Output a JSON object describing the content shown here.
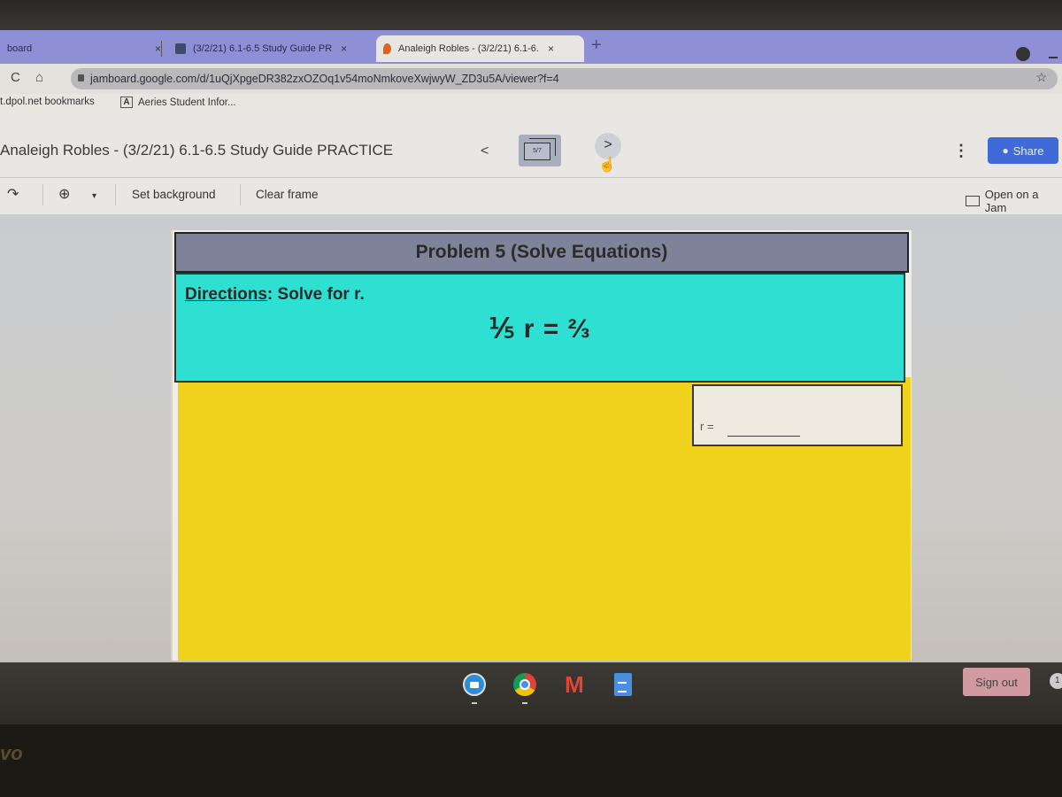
{
  "browser": {
    "tabs": [
      {
        "label": "board",
        "active": false
      },
      {
        "label": "(3/2/21) 6.1-6.5 Study Guide PR",
        "active": false,
        "icon": "classroom-icon"
      },
      {
        "label": "Analeigh Robles - (3/2/21) 6.1-6.",
        "active": true,
        "icon": "jamboard-icon"
      }
    ],
    "close_glyph": "×",
    "new_tab": "+",
    "url": "jamboard.google.com/d/1uQjXpgeDR382zxOZOq1v54moNmkoveXwjwyW_ZD3u5A/viewer?f=4",
    "bookmarks": [
      {
        "label": "t.dpol.net bookmarks"
      },
      {
        "label": "Aeries Student Infor..."
      }
    ],
    "reload_glyph": "C",
    "home_glyph": "⌂",
    "star_glyph": "☆"
  },
  "jamboard": {
    "title": "Analeigh Robles - (3/2/21) 6.1-6.5 Study Guide PRACTICE",
    "frame_indicator": "5/7",
    "prev_glyph": "<",
    "next_glyph": ">",
    "more_glyph": "⋮",
    "share_label": "Share",
    "toolbar": {
      "redo_glyph": "↷",
      "zoom_glyph": "⊕",
      "zoom_dropdown": "▾",
      "set_background": "Set background",
      "clear_frame": "Clear frame",
      "open_on_jamboard": "Open on a Jam"
    },
    "slide": {
      "header": "Problem 5 (Solve Equations)",
      "directions_label": "Directions",
      "directions_text": ": Solve for r.",
      "equation": "⅕ r = ⅔",
      "answer_label": "r ="
    }
  },
  "shelf": {
    "apps": [
      "zoom",
      "chrome",
      "gmail",
      "docs"
    ],
    "sign_out": "Sign out",
    "notification_count": "1"
  },
  "device_brand": "vo",
  "colors": {
    "header_bar": "#7f8399",
    "teal_panel": "#2ee0d2",
    "yellow_panel": "#f0d11b",
    "share_button": "#3f6ad8",
    "sign_out": "#d19aa0"
  }
}
